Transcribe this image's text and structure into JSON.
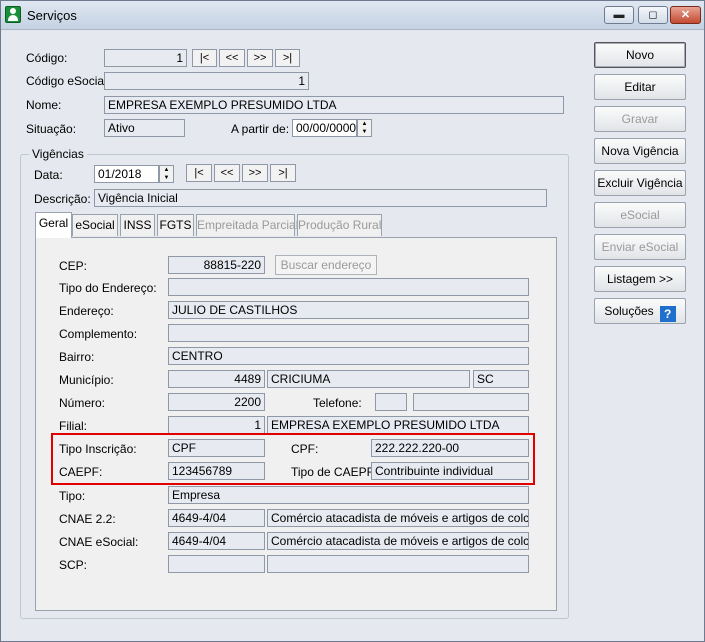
{
  "window": {
    "title": "Serviços",
    "controls": {
      "minimize": "▬",
      "maximize": "◻",
      "close": "✕"
    }
  },
  "nav_labels": {
    "first": "|<",
    "prev": "<<",
    "next": ">>",
    "last": ">|"
  },
  "spin_glyphs": {
    "up": "▲",
    "down": "▼"
  },
  "header": {
    "codigo_label": "Código:",
    "codigo_value": "1",
    "codigo_esocial_label": "Código eSocial:",
    "codigo_esocial_value": "1",
    "nome_label": "Nome:",
    "nome_value": "EMPRESA EXEMPLO PRESUMIDO LTDA",
    "situacao_label": "Situação:",
    "situacao_value": "Ativo",
    "a_partir_label": "A partir de:",
    "a_partir_value": "00/00/0000"
  },
  "vigencias": {
    "group_title": "Vigências",
    "data_label": "Data:",
    "data_value": "01/2018",
    "descricao_label": "Descrição:",
    "descricao_value": "Vigência Inicial"
  },
  "tabs": [
    {
      "label": "Geral",
      "active": true,
      "enabled": true
    },
    {
      "label": "eSocial",
      "active": false,
      "enabled": true
    },
    {
      "label": "INSS",
      "active": false,
      "enabled": true
    },
    {
      "label": "FGTS",
      "active": false,
      "enabled": true
    },
    {
      "label": "Empreitada Parcial",
      "active": false,
      "enabled": false
    },
    {
      "label": "Produção Rural",
      "active": false,
      "enabled": false
    }
  ],
  "geral": {
    "cep_label": "CEP:",
    "cep_value": "88815-220",
    "buscar_endereco": "Buscar endereço",
    "tipo_endereco_label": "Tipo do Endereço:",
    "tipo_endereco_value": "",
    "endereco_label": "Endereço:",
    "endereco_value": "JULIO DE CASTILHOS",
    "complemento_label": "Complemento:",
    "complemento_value": "",
    "bairro_label": "Bairro:",
    "bairro_value": "CENTRO",
    "municipio_label": "Município:",
    "municipio_code": "4489",
    "municipio_name": "CRICIUMA",
    "uf": "SC",
    "numero_label": "Número:",
    "numero_value": "2200",
    "telefone_label": "Telefone:",
    "telefone_ddd": "",
    "telefone_value": "",
    "filial_label": "Filial:",
    "filial_code": "1",
    "filial_name": "EMPRESA EXEMPLO PRESUMIDO LTDA",
    "tipo_inscricao_label": "Tipo Inscrição:",
    "tipo_inscricao_value": "CPF",
    "cpf_label": "CPF:",
    "cpf_value": "222.222.220-00",
    "caepf_label": "CAEPF:",
    "caepf_value": "123456789",
    "tipo_caepf_label": "Tipo de CAEPF:",
    "tipo_caepf_value": "Contribuinte individual",
    "tipo_label": "Tipo:",
    "tipo_value": "Empresa",
    "cnae22_label": "CNAE 2.2:",
    "cnae22_code": "4649-4/04",
    "cnae22_desc": "Comércio atacadista de móveis e artigos de colchoaria",
    "cnae_esocial_label": "CNAE eSocial:",
    "cnae_esocial_code": "4649-4/04",
    "cnae_esocial_desc": "Comércio atacadista de móveis e artigos de colchoaria",
    "scp_label": "SCP:",
    "scp_code": "",
    "scp_desc": ""
  },
  "actions": {
    "novo": "Novo",
    "editar": "Editar",
    "gravar": "Gravar",
    "nova_vigencia": "Nova Vigência",
    "excluir_vigencia": "Excluir Vigência",
    "esocial": "eSocial",
    "enviar_esocial": "Enviar eSocial",
    "listagem": "Listagem >>",
    "solucoes": "Soluções",
    "help_glyph": "?"
  },
  "colors": {
    "highlight": "#e00000",
    "help_icon": "#1f6fcc"
  }
}
